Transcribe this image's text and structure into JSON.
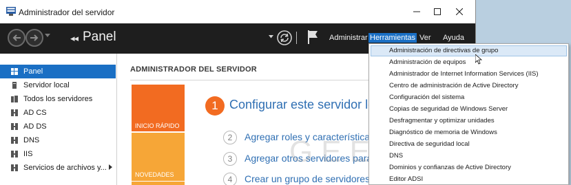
{
  "window": {
    "title": "Administrador del servidor"
  },
  "toolbar": {
    "breadcrumb_chevrons": "◂◂",
    "breadcrumb_title": "Panel",
    "menus": [
      "Administrar",
      "Herramientas",
      "Ver",
      "Ayuda"
    ],
    "active_menu": "Herramientas"
  },
  "sidebar": {
    "items": [
      {
        "label": "Panel",
        "icon": "dashboard-icon"
      },
      {
        "label": "Servidor local",
        "icon": "server-icon"
      },
      {
        "label": "Todos los servidores",
        "icon": "servers-icon"
      },
      {
        "label": "AD CS",
        "icon": "adcs-icon"
      },
      {
        "label": "AD DS",
        "icon": "adds-icon"
      },
      {
        "label": "DNS",
        "icon": "dns-icon"
      },
      {
        "label": "IIS",
        "icon": "iis-icon"
      },
      {
        "label": "Servicios de archivos y...",
        "icon": "file-services-icon"
      }
    ]
  },
  "content": {
    "section_title": "ADMINISTRADOR DEL SERVIDOR",
    "tiles": [
      "INICIO RÁPIDO",
      "NOVEDADES"
    ],
    "steps": [
      {
        "num": "1",
        "text": "Configurar este servidor lo"
      },
      {
        "num": "2",
        "text": "Agregar roles y características"
      },
      {
        "num": "3",
        "text": "Agregar otros servidores para"
      },
      {
        "num": "4",
        "text": "Crear un grupo de servidores"
      }
    ]
  },
  "tools_menu": {
    "items": [
      "Administración de directivas de grupo",
      "Administración de equipos",
      "Administrador de Internet Information Services (IIS)",
      "Centro de administración de Active Directory",
      "Configuración del sistema",
      "Copias de seguridad de Windows Server",
      "Desfragmentar y optimizar unidades",
      "Diagnóstico de memoria de Windows",
      "Directiva de seguridad local",
      "DNS",
      "Dominios y confianzas de Active Directory",
      "Editor ADSI"
    ],
    "highlighted": "Administración de directivas de grupo"
  },
  "watermark": "GEEKNETIC",
  "colors": {
    "accent": "#1a6fc4",
    "toolbar_bg": "#1e1e1e",
    "quick_start": "#f26b21",
    "news": "#f6a637",
    "link": "#2f6fb3"
  }
}
